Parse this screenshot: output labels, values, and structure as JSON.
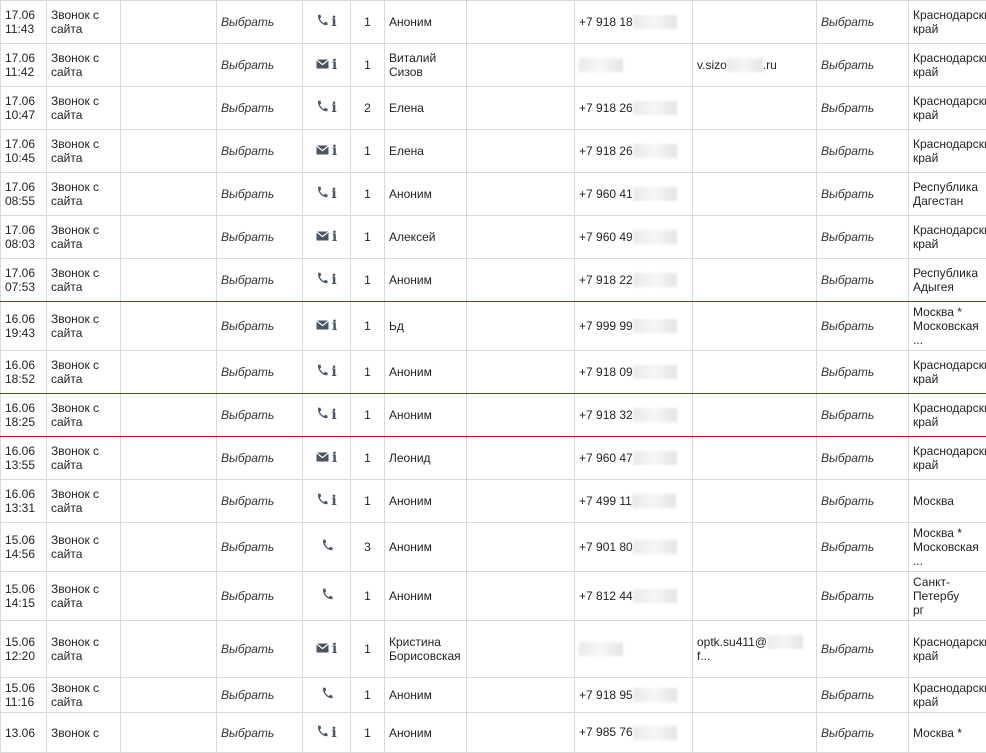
{
  "select_label": "Выбрать",
  "rows": [
    {
      "date": "17.06\n11:43",
      "source": "Звонок с\nсайта",
      "type": "phone",
      "info": true,
      "count": "1",
      "name": "Аноним",
      "phone": "+7 918 18",
      "email": "",
      "region": "Краснодарский\nкрай",
      "flag": false
    },
    {
      "date": "17.06\n11:42",
      "source": "Звонок с\nсайта",
      "type": "mail",
      "info": true,
      "count": "1",
      "name": "Виталий\nСизов",
      "phone": "",
      "email": "v.sizo",
      "email_tail": ".ru",
      "region": "Краснодарский\nкрай",
      "flag": false
    },
    {
      "date": "17.06\n10:47",
      "source": "Звонок с\nсайта",
      "type": "phone",
      "info": true,
      "count": "2",
      "name": "Елена",
      "phone": "+7 918 26",
      "email": "",
      "region": "Краснодарский\nкрай",
      "flag": false
    },
    {
      "date": "17.06\n10:45",
      "source": "Звонок с\nсайта",
      "type": "mail",
      "info": true,
      "count": "1",
      "name": "Елена",
      "phone": "+7 918 26",
      "email": "",
      "region": "Краснодарский\nкрай",
      "flag": false
    },
    {
      "date": "17.06\n08:55",
      "source": "Звонок с\nсайта",
      "type": "phone",
      "info": true,
      "count": "1",
      "name": "Аноним",
      "phone": "+7 960 41",
      "email": "",
      "region": "Республика\nДагестан",
      "flag": false
    },
    {
      "date": "17.06\n08:03",
      "source": "Звонок с\nсайта",
      "type": "mail",
      "info": true,
      "count": "1",
      "name": "Алексей",
      "phone": "+7 960 49",
      "email": "",
      "region": "Краснодарский\nкрай",
      "flag": false
    },
    {
      "date": "17.06\n07:53",
      "source": "Звонок с\nсайта",
      "type": "phone",
      "info": true,
      "count": "1",
      "name": "Аноним",
      "phone": "+7 918 22",
      "email": "",
      "region": "Республика\nАдыгея",
      "flag": true
    },
    {
      "date": "16.06\n19:43",
      "source": "Звонок с\nсайта",
      "type": "mail",
      "info": true,
      "count": "1",
      "name": "Ьд",
      "phone": "+7 999 99",
      "email": "",
      "region": "Москва *\nМосковская ...",
      "flag": false
    },
    {
      "date": "16.06\n18:52",
      "source": "Звонок с\nсайта",
      "type": "phone",
      "info": true,
      "count": "1",
      "name": "Аноним",
      "phone": "+7 918 09",
      "email": "",
      "region": "Краснодарский\nкрай",
      "flag": true
    },
    {
      "date": "16.06\n18:25",
      "source": "Звонок с\nсайта",
      "type": "phone",
      "info": true,
      "count": "1",
      "name": "Аноним",
      "phone": "+7 918 32",
      "email": "",
      "region": "Краснодарский\nкрай",
      "flag": true
    },
    {
      "date": "16.06\n13:55",
      "source": "Звонок с\nсайта",
      "type": "mail",
      "info": true,
      "count": "1",
      "name": "Леонид",
      "phone": "+7 960 47",
      "email": "",
      "region": "Краснодарский\nкрай",
      "flag": false
    },
    {
      "date": "16.06\n13:31",
      "source": "Звонок с\nсайта",
      "type": "phone",
      "info": true,
      "count": "1",
      "name": "Аноним",
      "phone": "+7 499 11",
      "email": "",
      "region": "Москва",
      "flag": false
    },
    {
      "date": "15.06\n14:56",
      "source": "Звонок с\nсайта",
      "type": "phone",
      "info": false,
      "count": "3",
      "name": "Аноним",
      "phone": "+7 901 80",
      "email": "",
      "region": "Москва *\nМосковская ...",
      "flag": false
    },
    {
      "date": "15.06\n14:15",
      "source": "Звонок с\nсайта",
      "type": "phone",
      "info": false,
      "count": "1",
      "name": "Аноним",
      "phone": "+7 812 44",
      "email": "",
      "region": "Санкт-Петербу\nрг",
      "flag": false
    },
    {
      "date": "15.06\n12:20",
      "source": "Звонок с\nсайта",
      "type": "mail",
      "info": true,
      "count": "1",
      "name": "Кристина\nБорисовская",
      "phone": "",
      "email": "optk.su411@",
      "email_tail": "f...",
      "region": "Краснодарский\nкрай",
      "flag": false
    },
    {
      "date": "15.06\n11:16",
      "source": "Звонок с\nсайта",
      "type": "phone",
      "info": false,
      "count": "1",
      "name": "Аноним",
      "phone": "+7 918 95",
      "email": "",
      "region": "Краснодарский\nкрай",
      "flag": false
    },
    {
      "date": "13.06\n",
      "source": "Звонок с\n",
      "type": "phone",
      "info": true,
      "count": "1",
      "name": "Аноним",
      "phone": "+7 985 76",
      "email": "",
      "region": "Москва *\n",
      "flag": false
    }
  ]
}
